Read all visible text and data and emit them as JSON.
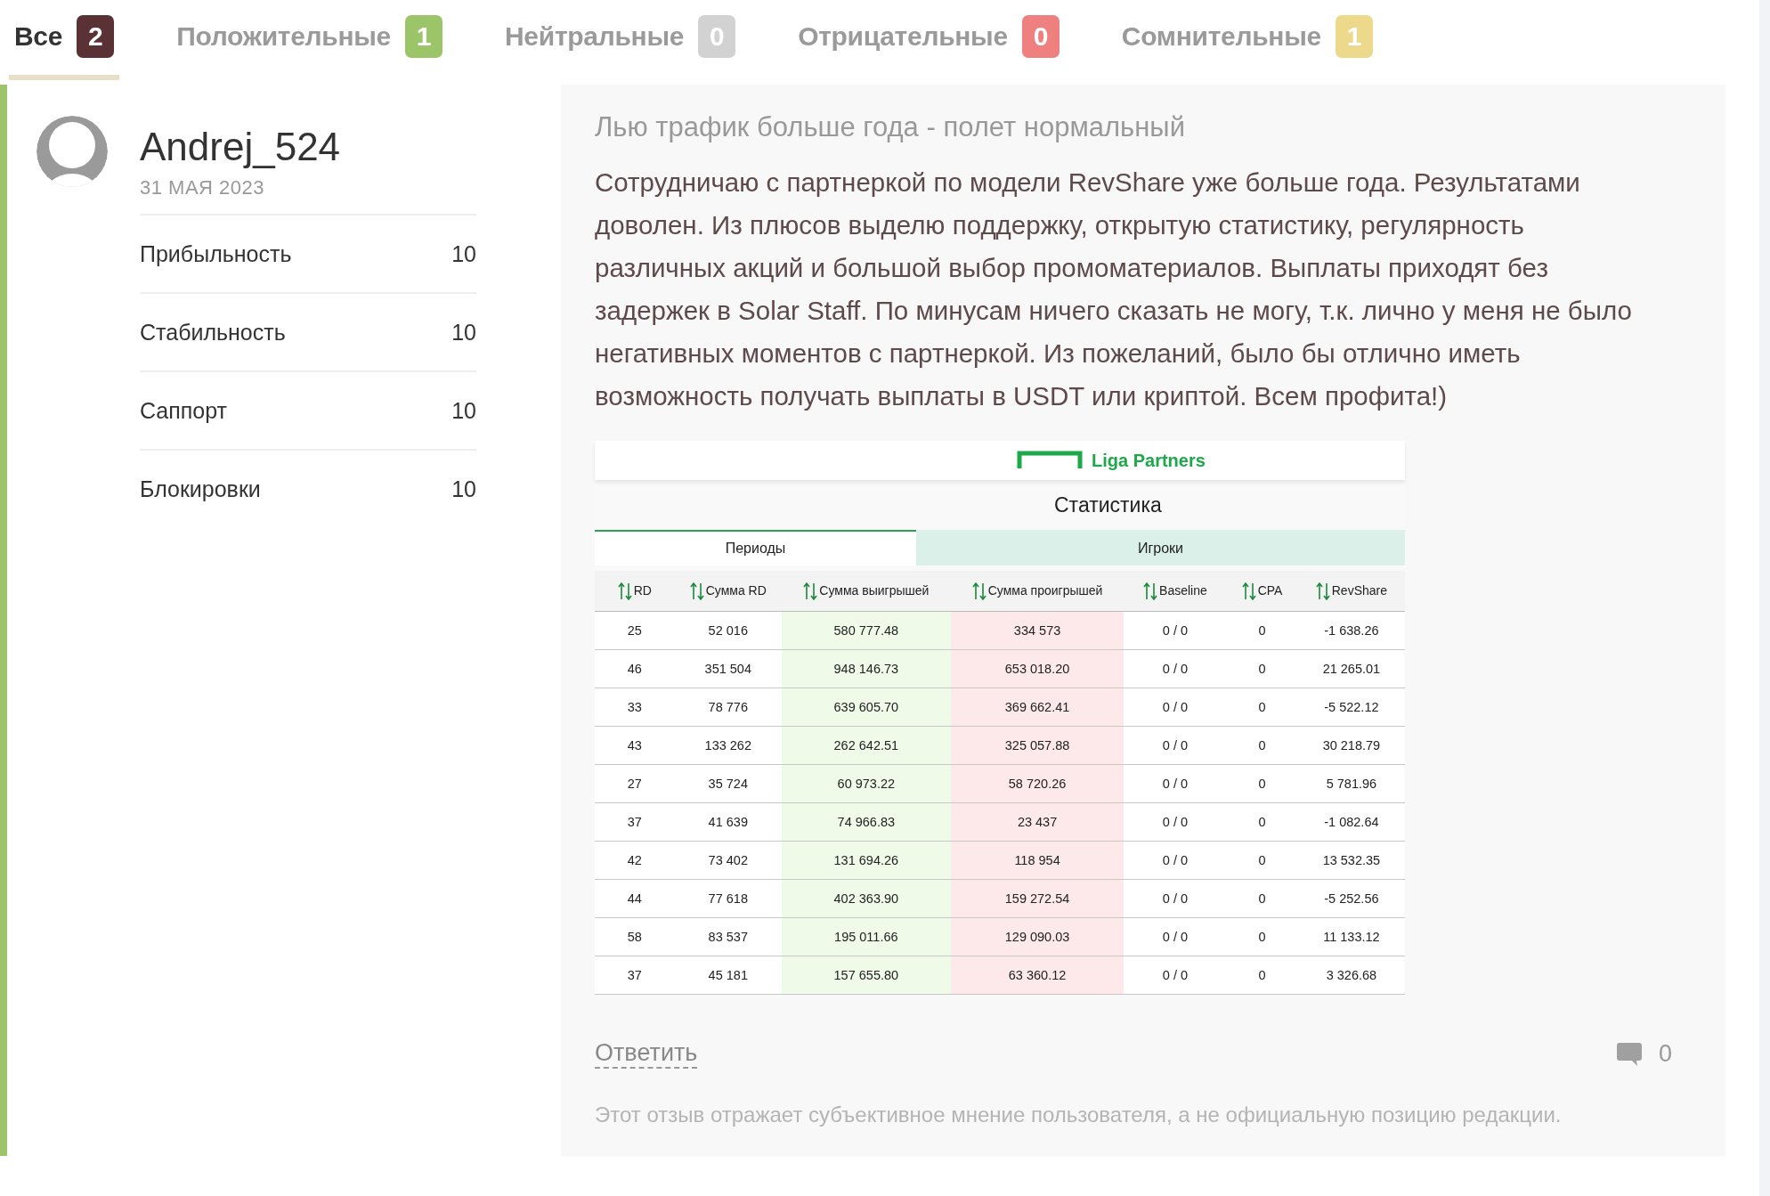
{
  "tabs": [
    {
      "label": "Все",
      "count": "2",
      "color": "#5a3236",
      "selected": true
    },
    {
      "label": "Положительные",
      "count": "1",
      "color": "#9cc56a",
      "selected": false
    },
    {
      "label": "Нейтральные",
      "count": "0",
      "color": "#d2d2d2",
      "selected": false
    },
    {
      "label": "Отрицательные",
      "count": "0",
      "color": "#ef8080",
      "selected": false
    },
    {
      "label": "Сомнительные",
      "count": "1",
      "color": "#ecd98c",
      "selected": false
    }
  ],
  "review": {
    "color": "#9cc56a",
    "author": {
      "name": "Andrej_524",
      "date": "31 МАЯ 2023"
    },
    "ratings": [
      {
        "label": "Прибыльность",
        "value": "10"
      },
      {
        "label": "Стабильность",
        "value": "10"
      },
      {
        "label": "Саппорт",
        "value": "10"
      },
      {
        "label": "Блокировки",
        "value": "10"
      }
    ],
    "title": "Лью трафик больше года - полет нормальный",
    "body": "Сотрудничаю с партнеркой по модели RevShare уже больше года. Результатами доволен. Из плюсов выделю поддержку, открытую статистику, регулярность различных акций и большой выбор промоматериалов. Выплаты приходят без задержек в Solar Staff. По минусам ничего сказать не могу, т.к. лично у меня не было негативных моментов с партнеркой. Из пожеланий, было бы отлично иметь возможность получать выплаты в USDT или криптой. Всем профита!)",
    "screenshot": {
      "logo": "Liga Partners",
      "heading": "Статистика",
      "tabs": [
        {
          "label": "Периоды",
          "selected": true
        },
        {
          "label": "Игроки",
          "selected": false
        }
      ],
      "columns": [
        {
          "label": "RD",
          "kind": "plain"
        },
        {
          "label": "Сумма RD",
          "kind": "plain"
        },
        {
          "label": "Сумма выигрышей",
          "kind": "win"
        },
        {
          "label": "Сумма проигрышей",
          "kind": "loss"
        },
        {
          "label": "Baseline",
          "kind": "plain"
        },
        {
          "label": "CPA",
          "kind": "plain"
        },
        {
          "label": "RevShare",
          "kind": "plain"
        }
      ],
      "rows": [
        [
          "25",
          "52 016",
          "580 777.48",
          "334 573",
          "0 / 0",
          "0",
          "-1 638.26"
        ],
        [
          "46",
          "351 504",
          "948 146.73",
          "653 018.20",
          "0 / 0",
          "0",
          "21 265.01"
        ],
        [
          "33",
          "78 776",
          "639 605.70",
          "369 662.41",
          "0 / 0",
          "0",
          "-5 522.12"
        ],
        [
          "43",
          "133 262",
          "262 642.51",
          "325 057.88",
          "0 / 0",
          "0",
          "30 218.79"
        ],
        [
          "27",
          "35 724",
          "60 973.22",
          "58 720.26",
          "0 / 0",
          "0",
          "5 781.96"
        ],
        [
          "37",
          "41 639",
          "74 966.83",
          "23 437",
          "0 / 0",
          "0",
          "-1 082.64"
        ],
        [
          "42",
          "73 402",
          "131 694.26",
          "118 954",
          "0 / 0",
          "0",
          "13 532.35"
        ],
        [
          "44",
          "77 618",
          "402 363.90",
          "159 272.54",
          "0 / 0",
          "0",
          "-5 252.56"
        ],
        [
          "58",
          "83 537",
          "195 011.66",
          "129 090.03",
          "0 / 0",
          "0",
          "11 133.12"
        ],
        [
          "37",
          "45 181",
          "157 655.80",
          "63 360.12",
          "0 / 0",
          "0",
          "3 326.68"
        ]
      ]
    },
    "reply": "Ответить",
    "comments": "0",
    "disclaimer": "Этот отзыв отражает субъективное мнение пользователя, а не официальную позицию редакции."
  }
}
